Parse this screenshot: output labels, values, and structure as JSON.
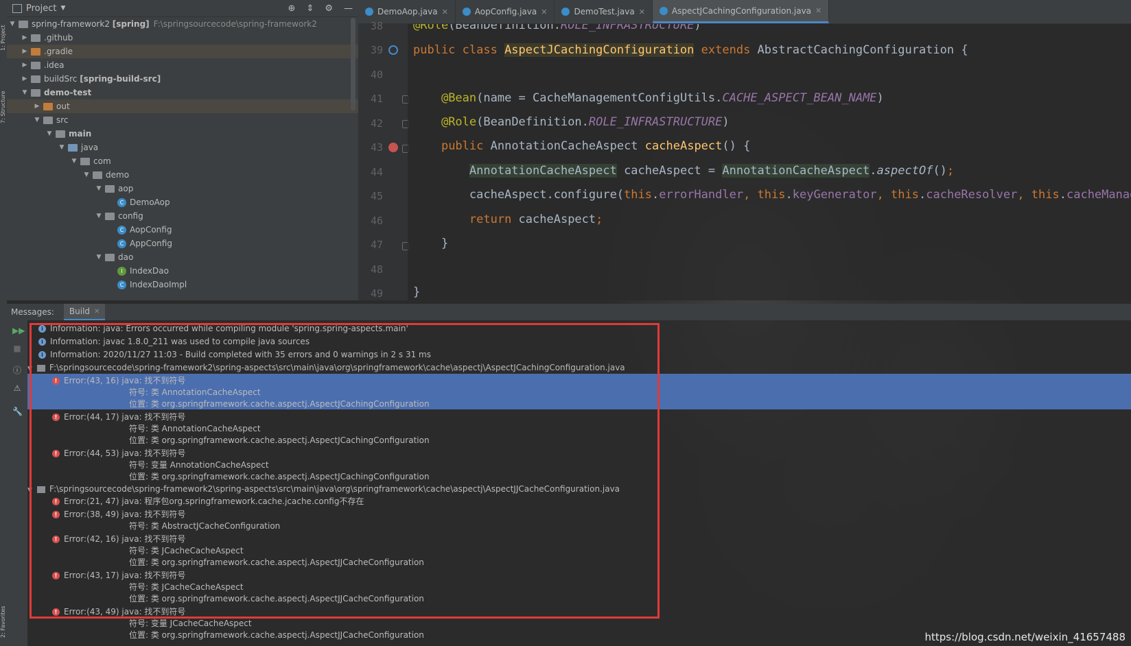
{
  "project_panel": {
    "title": "Project",
    "tree": [
      {
        "label": "spring-framework2",
        "suffix": "[spring]",
        "path": "F:\\springsourcecode\\spring-framework2"
      },
      {
        "label": ".github"
      },
      {
        "label": ".gradle"
      },
      {
        "label": ".idea"
      },
      {
        "label": "buildSrc",
        "suffix": "[spring-build-src]"
      },
      {
        "label": "demo-test"
      },
      {
        "label": "out"
      },
      {
        "label": "src"
      },
      {
        "label": "main"
      },
      {
        "label": "java"
      },
      {
        "label": "com"
      },
      {
        "label": "demo"
      },
      {
        "label": "aop"
      },
      {
        "label": "DemoAop"
      },
      {
        "label": "config"
      },
      {
        "label": "AopConfig"
      },
      {
        "label": "AppConfig"
      },
      {
        "label": "dao"
      },
      {
        "label": "IndexDao"
      },
      {
        "label": "IndexDaoImpl"
      }
    ]
  },
  "side_tabs": {
    "project": "1: Project",
    "structure": "7: Structure",
    "favorites": "2: Favorites"
  },
  "editor": {
    "tabs": [
      "DemoAop.java",
      "AopConfig.java",
      "DemoTest.java",
      "AspectJCachingConfiguration.java"
    ],
    "active_tab": "AspectJCachingConfiguration.java",
    "line_numbers": [
      "38",
      "39",
      "40",
      "41",
      "42",
      "43",
      "44",
      "45",
      "46",
      "47",
      "48",
      "49"
    ]
  },
  "messages": {
    "label": "Messages:",
    "tab": "Build",
    "lines": [
      "Information: java: Errors occurred while compiling module 'spring.spring-aspects.main'",
      "Information: javac 1.8.0_211 was used to compile java sources",
      "Information: 2020/11/27 11:03 - Build completed with 35 errors and 0 warnings in 2 s 31 ms",
      "F:\\springsourcecode\\spring-framework2\\spring-aspects\\src\\main\\java\\org\\springframework\\cache\\aspectj\\AspectJCachingConfiguration.java",
      "Error:(43, 16)  java: 找不到符号",
      "符号:   类 AnnotationCacheAspect",
      "位置: 类 org.springframework.cache.aspectj.AspectJCachingConfiguration",
      "Error:(44, 17)  java: 找不到符号",
      "符号:   类 AnnotationCacheAspect",
      "位置: 类 org.springframework.cache.aspectj.AspectJCachingConfiguration",
      "Error:(44, 53)  java: 找不到符号",
      "符号:   变量 AnnotationCacheAspect",
      "位置: 类 org.springframework.cache.aspectj.AspectJCachingConfiguration",
      "F:\\springsourcecode\\spring-framework2\\spring-aspects\\src\\main\\java\\org\\springframework\\cache\\aspectj\\AspectJJCacheConfiguration.java",
      "Error:(21, 47)  java: 程序包org.springframework.cache.jcache.config不存在",
      "Error:(38, 49)  java: 找不到符号",
      "符号: 类 AbstractJCacheConfiguration",
      "Error:(42, 16)  java: 找不到符号",
      "符号:   类 JCacheCacheAspect",
      "位置: 类 org.springframework.cache.aspectj.AspectJJCacheConfiguration",
      "Error:(43, 17)  java: 找不到符号",
      "符号:   类 JCacheCacheAspect",
      "位置: 类 org.springframework.cache.aspectj.AspectJJCacheConfiguration",
      "Error:(43, 49)  java: 找不到符号",
      "符号:   变量 JCacheCacheAspect",
      "位置: 类 org.springframework.cache.aspectj.AspectJJCacheConfiguration"
    ]
  },
  "watermark": "https://blog.csdn.net/weixin_41657488",
  "colors": {
    "accent": "#4a88c7",
    "error": "#d7504f",
    "selection": "#4b6eaf",
    "highlight_box": "#e03a3a"
  }
}
